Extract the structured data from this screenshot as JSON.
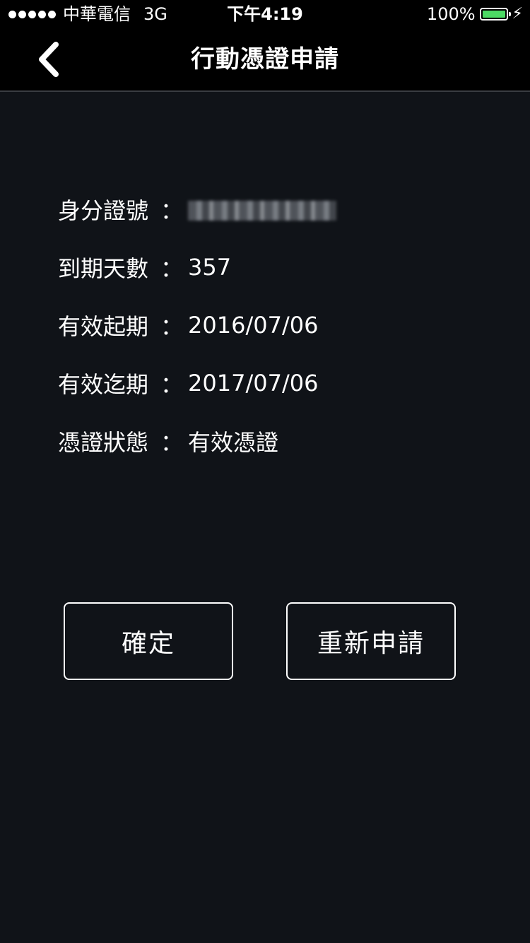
{
  "status_bar": {
    "carrier": "中華電信",
    "network": "3G",
    "time": "下午4:19",
    "battery": "100%",
    "battery_color": "#4cd964"
  },
  "nav": {
    "title": "行動憑證申請",
    "back_icon": "chevron-left-icon"
  },
  "info": {
    "rows": [
      {
        "label": "身分證號",
        "value": ""
      },
      {
        "label": "到期天數",
        "value": "357"
      },
      {
        "label": "有效起期",
        "value": "2016/07/06"
      },
      {
        "label": "有效迄期",
        "value": "2017/07/06"
      },
      {
        "label": "憑證狀態",
        "value": "有效憑證"
      }
    ],
    "colon": "："
  },
  "buttons": {
    "confirm": "確定",
    "reapply": "重新申請"
  }
}
